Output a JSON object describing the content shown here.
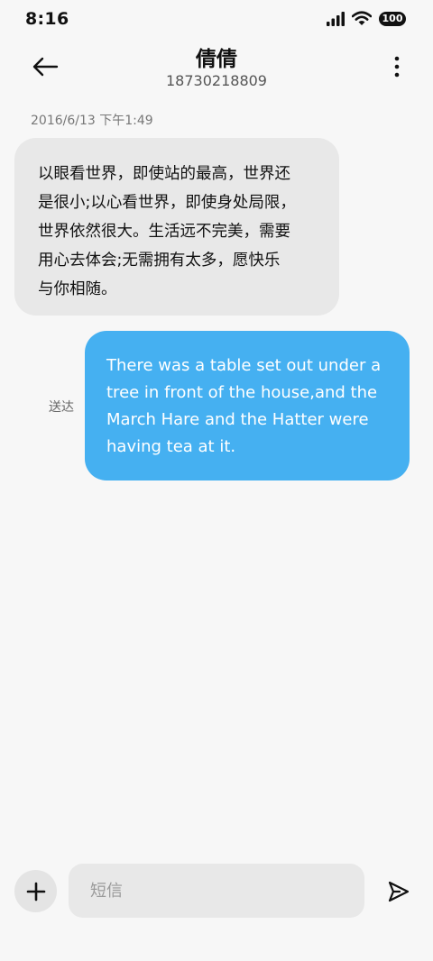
{
  "status_bar": {
    "time": "8:16",
    "battery": "100",
    "icons": [
      "signal-icon",
      "wifi-icon",
      "battery-icon"
    ]
  },
  "header": {
    "back_icon": "arrow-left-icon",
    "contact_name": "倩倩",
    "contact_number": "18730218809",
    "more_icon": "more-vertical-icon"
  },
  "conversation": {
    "timestamp": "2016/6/13 下午1:49",
    "messages": [
      {
        "direction": "incoming",
        "lines": [
          "以眼看世界，即使站的最高，世界还",
          "是很小;以心看世界，即使身处局限，",
          "世界依然很大。生活远不完美，需要",
          "用心去体会;无需拥有太多，愿快乐",
          "与你相随。"
        ]
      },
      {
        "direction": "outgoing",
        "status": "送达",
        "lines": [
          "There was a table set out under a",
          "tree in front of the house,and the",
          "March Hare and the Hatter were",
          "having tea at it."
        ]
      }
    ]
  },
  "composer": {
    "add_icon": "plus-icon",
    "input_value": "",
    "input_placeholder": "短信",
    "send_icon": "send-icon"
  },
  "colors": {
    "background": "#f7f7f7",
    "incoming_bubble": "#e8e8e8",
    "outgoing_bubble": "#45b0f1",
    "outgoing_text": "#ffffff"
  }
}
